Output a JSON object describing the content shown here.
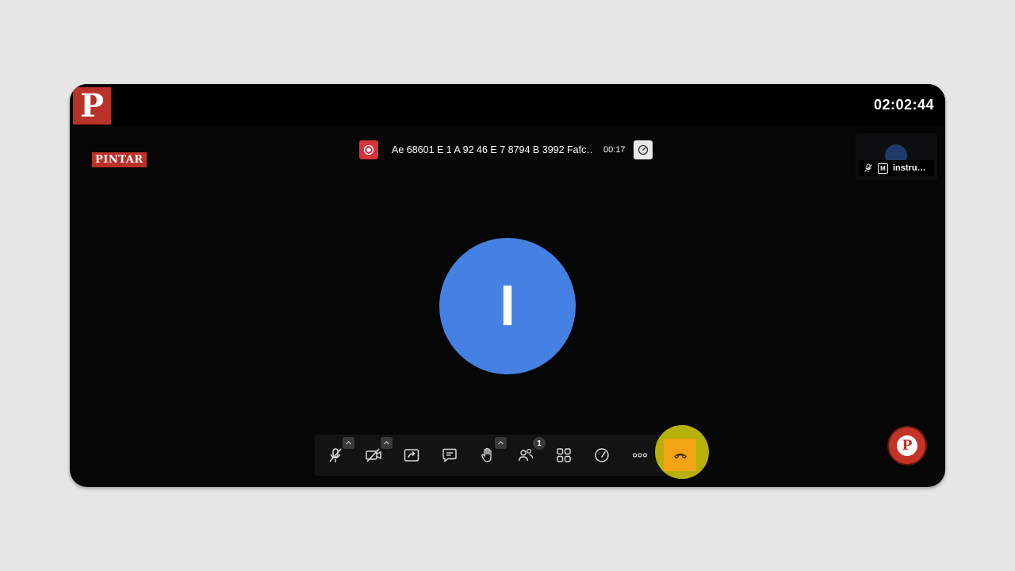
{
  "header": {
    "logo_letter": "P",
    "clock": "02:02:44"
  },
  "brand": {
    "badge_text": "PINTAR"
  },
  "recording": {
    "title": "Ae 68601 E 1 A 92 46 E 7 8794 B 3992 Fafc…",
    "elapsed": "00:17",
    "record_icon": "record-icon",
    "speed_icon": "speedometer-icon"
  },
  "self_view": {
    "label": "instru…",
    "badge": "M",
    "mic_icon": "mic-off-icon"
  },
  "main_participant": {
    "initial": "I",
    "color": "#4580e3"
  },
  "toolbar": {
    "buttons": [
      {
        "name": "microphone",
        "icon": "mic-off-icon",
        "has_caret": true
      },
      {
        "name": "camera",
        "icon": "camera-off-icon",
        "has_caret": true
      },
      {
        "name": "share-screen",
        "icon": "share-screen-icon",
        "has_caret": false
      },
      {
        "name": "chat",
        "icon": "chat-icon",
        "has_caret": false
      },
      {
        "name": "raise-hand",
        "icon": "hand-icon",
        "has_caret": true
      },
      {
        "name": "participants",
        "icon": "participants-icon",
        "badge": "1"
      },
      {
        "name": "tile-view",
        "icon": "grid-icon",
        "has_caret": false
      },
      {
        "name": "performance",
        "icon": "speedometer-icon",
        "has_caret": false
      },
      {
        "name": "more",
        "icon": "more-icon",
        "has_caret": false
      }
    ],
    "hangup_icon": "hangup-icon",
    "hangup_color": "#f2a316",
    "highlight_color": "#b5b10a"
  },
  "floating": {
    "logo_letter": "P"
  }
}
